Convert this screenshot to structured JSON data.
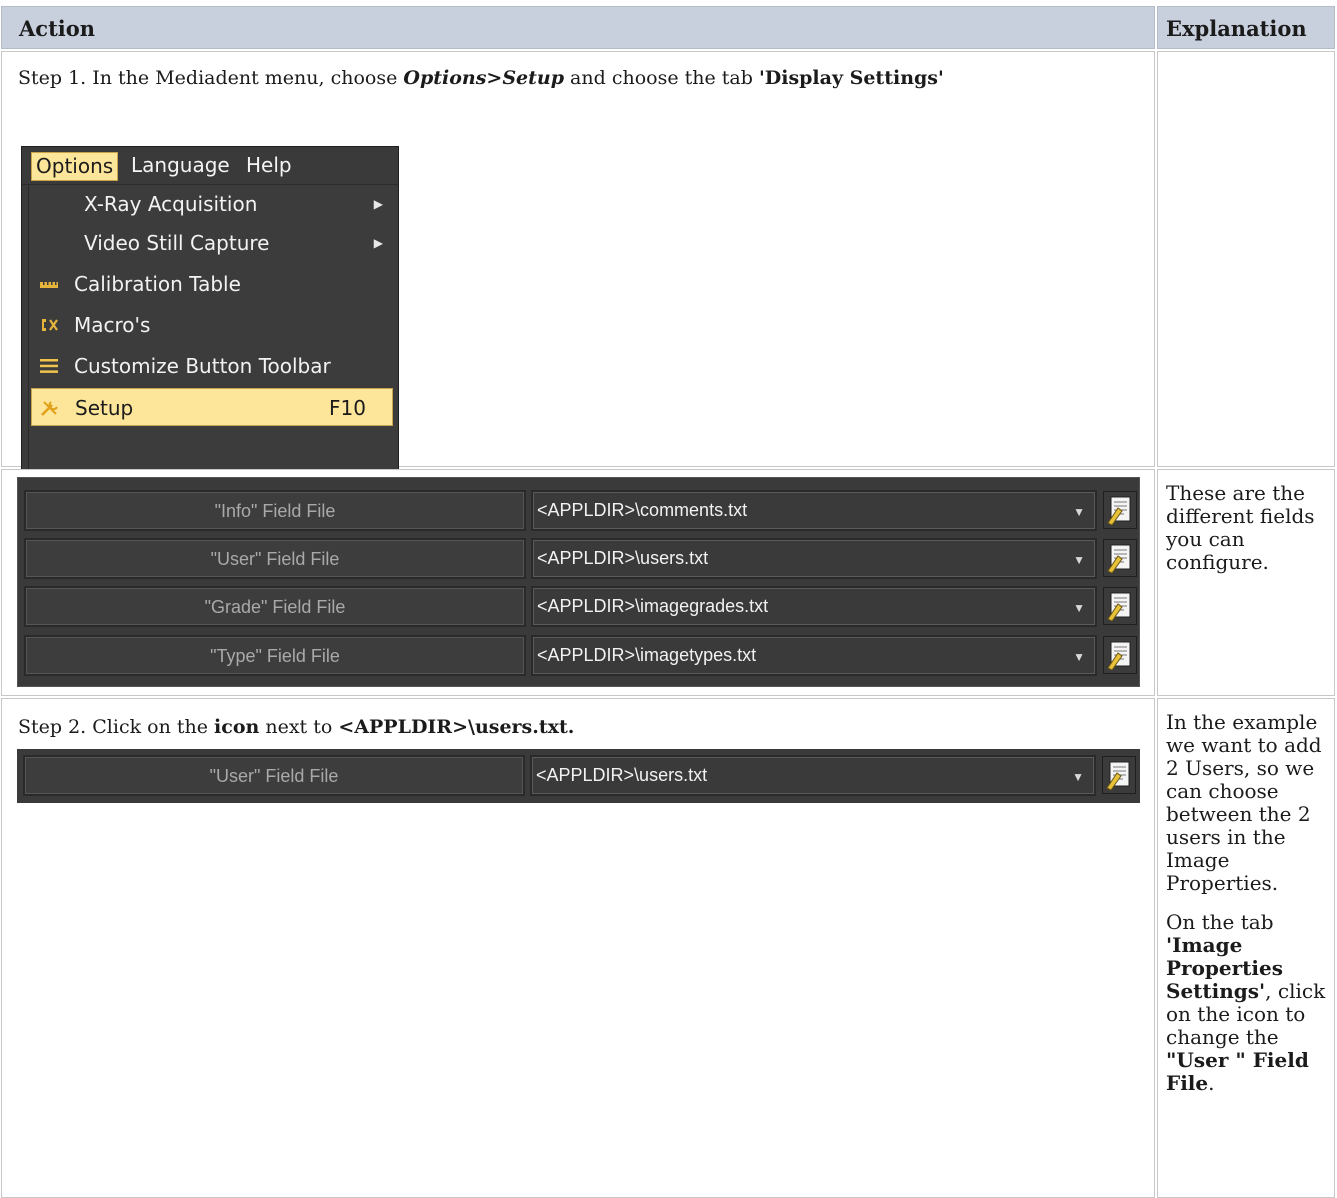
{
  "table": {
    "col_action": "Action",
    "col_explanation": "Explanation"
  },
  "step1": {
    "text_a": "Step 1. In the Mediadent menu, choose ",
    "text_path": "Options>Setup",
    "text_b": " and choose the tab ",
    "text_tab": "'Display Settings'"
  },
  "menu": {
    "bar": [
      "Options",
      "Language",
      "Help"
    ],
    "items": [
      {
        "label": "X-Ray Acquisition",
        "submenu": true,
        "icon": ""
      },
      {
        "label": "Video Still Capture",
        "submenu": true,
        "icon": ""
      },
      {
        "label": "Calibration Table",
        "submenu": false,
        "icon": "ruler-icon"
      },
      {
        "label": "Macro's",
        "submenu": false,
        "icon": "macro-icon"
      },
      {
        "label": "Customize Button Toolbar",
        "submenu": false,
        "icon": "hamburger-icon"
      },
      {
        "label": "Setup",
        "submenu": false,
        "icon": "wrench-screwdriver-icon",
        "shortcut": "F10",
        "selected": true
      }
    ],
    "submenu_arrow": "▶"
  },
  "fields": [
    {
      "label": "\"Info\" Field File",
      "value": "<APPLDIR>\\comments.txt"
    },
    {
      "label": "\"User\" Field File",
      "value": "<APPLDIR>\\users.txt"
    },
    {
      "label": "\"Grade\" Field File",
      "value": "<APPLDIR>\\imagegrades.txt"
    },
    {
      "label": "\"Type\" Field File",
      "value": "<APPLDIR>\\imagetypes.txt"
    }
  ],
  "explanation1": "These are the different fields you can configure.",
  "step2": {
    "text_a": "Step 2. Click on the ",
    "text_icon": "icon",
    "text_b": " next to ",
    "text_path": "<APPLDIR>\\users.txt."
  },
  "field_single": {
    "label": "\"User\" Field File",
    "value": "<APPLDIR>\\users.txt"
  },
  "explanation2": {
    "p1": "In the example we want to add 2 Users, so we can choose between the 2 users in the Image Properties.",
    "p2_a": "On the tab ",
    "p2_tab": "'Image Properties Settings'",
    "p2_b": ", click on the icon to change the ",
    "p2_field": "\"User \" Field File",
    "p2_c": "."
  },
  "colors": {
    "header_bg": "#c9d0dd",
    "menu_highlight": "#fde59a",
    "dark_panel": "#3a3a3a"
  }
}
